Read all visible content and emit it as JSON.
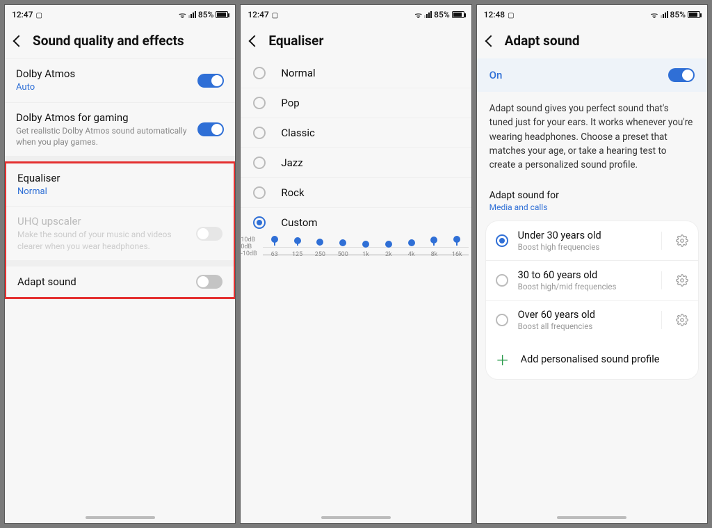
{
  "status": {
    "time_a": "12:47",
    "time_b": "12:47",
    "time_c": "12:48",
    "battery": "85%"
  },
  "screen1": {
    "title": "Sound quality and effects",
    "dolby": {
      "title": "Dolby Atmos",
      "sub": "Auto"
    },
    "dolby_gaming": {
      "title": "Dolby Atmos for gaming",
      "sub": "Get realistic Dolby Atmos sound automatically when you play games."
    },
    "equaliser": {
      "title": "Equaliser",
      "sub": "Normal"
    },
    "uhq": {
      "title": "UHQ upscaler",
      "sub": "Make the sound of your music and videos clearer when you wear headphones."
    },
    "adapt": {
      "title": "Adapt sound"
    }
  },
  "screen2": {
    "title": "Equaliser",
    "options": [
      "Normal",
      "Pop",
      "Classic",
      "Jazz",
      "Rock",
      "Custom"
    ],
    "selected": "Custom"
  },
  "chart_data": {
    "type": "bar",
    "title": "",
    "xlabel": "",
    "ylabel": "",
    "ylim": [
      -10,
      10
    ],
    "yticks": [
      "10dB",
      "0dB",
      "-10dB"
    ],
    "categories": [
      "63",
      "125",
      "250",
      "500",
      "1k",
      "2k",
      "4k",
      "8k",
      "16k"
    ],
    "values": [
      7,
      4,
      0,
      -2,
      -6,
      -6,
      -1,
      5,
      8
    ]
  },
  "screen3": {
    "title": "Adapt sound",
    "on": "On",
    "desc": "Adapt sound gives you perfect sound that's tuned just for your ears. It works whenever you're wearing headphones. Choose a preset that matches your age, or take a hearing test to create a personalized sound profile.",
    "section": {
      "t": "Adapt sound for",
      "s": "Media and calls"
    },
    "ages": [
      {
        "title": "Under 30 years old",
        "sub": "Boost high frequencies"
      },
      {
        "title": "30 to 60 years old",
        "sub": "Boost high/mid frequencies"
      },
      {
        "title": "Over 60 years old",
        "sub": "Boost all frequencies"
      }
    ],
    "add": "Add personalised sound profile"
  }
}
